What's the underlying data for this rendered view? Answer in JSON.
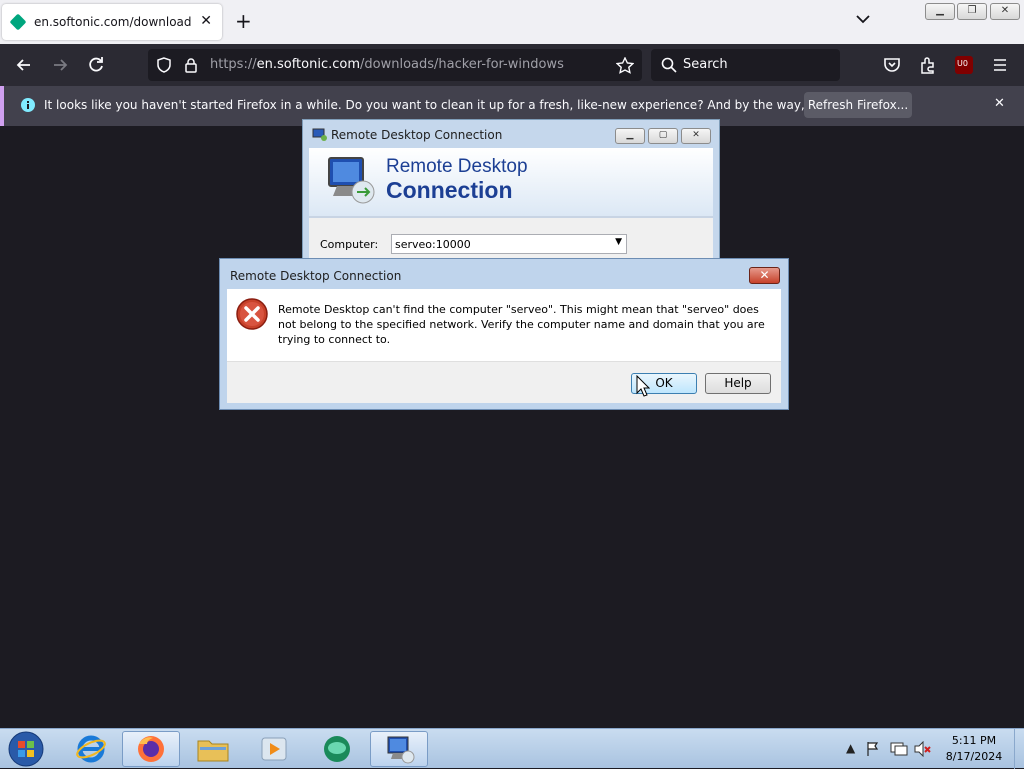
{
  "browser": {
    "tab": {
      "title": "en.softonic.com/downloads/ha",
      "close": "✕"
    },
    "new_tab": "+",
    "window_controls": [
      "minimize",
      "restore",
      "close"
    ],
    "url": {
      "prefix": "https://",
      "host": "en.softonic.com",
      "path": "/downloads/hacker-for-windows"
    },
    "search_placeholder": "Search",
    "nav_icons": [
      "back-icon",
      "forward-icon",
      "reload-icon",
      "shield-icon",
      "lock-icon",
      "star-icon",
      "pocket-icon",
      "extensions-icon",
      "ublock-icon",
      "menu-icon"
    ],
    "ublock_badge": "U0"
  },
  "notification": {
    "text": "It looks like you haven't started Firefox in a while. Do you want to clean it up for a fresh, like-new experience? And by the way, welcome back!",
    "button": "Refresh Firefox...",
    "close": "✕"
  },
  "rdc_window": {
    "title": "Remote Desktop Connection",
    "banner_line1": "Remote Desktop",
    "banner_line2": "Connection",
    "computer_label": "Computer:",
    "computer_value": "serveo:10000"
  },
  "error_dialog": {
    "title": "Remote Desktop Connection",
    "message": "Remote Desktop can't find the computer \"serveo\". This might mean that \"serveo\" does not belong to the specified network.  Verify the computer name and domain that you are trying to connect to.",
    "ok_label": "OK",
    "help_label": "Help",
    "close": "✕"
  },
  "taskbar": {
    "apps": [
      "start-orb",
      "internet-explorer",
      "firefox",
      "file-explorer",
      "media-player",
      "green-app",
      "remote-desktop"
    ],
    "time": "5:11 PM",
    "date": "8/17/2024"
  },
  "colors": {
    "accent": "#1c3f94",
    "error_red": "#c7412a",
    "firefox_dark": "#2b2a33"
  }
}
